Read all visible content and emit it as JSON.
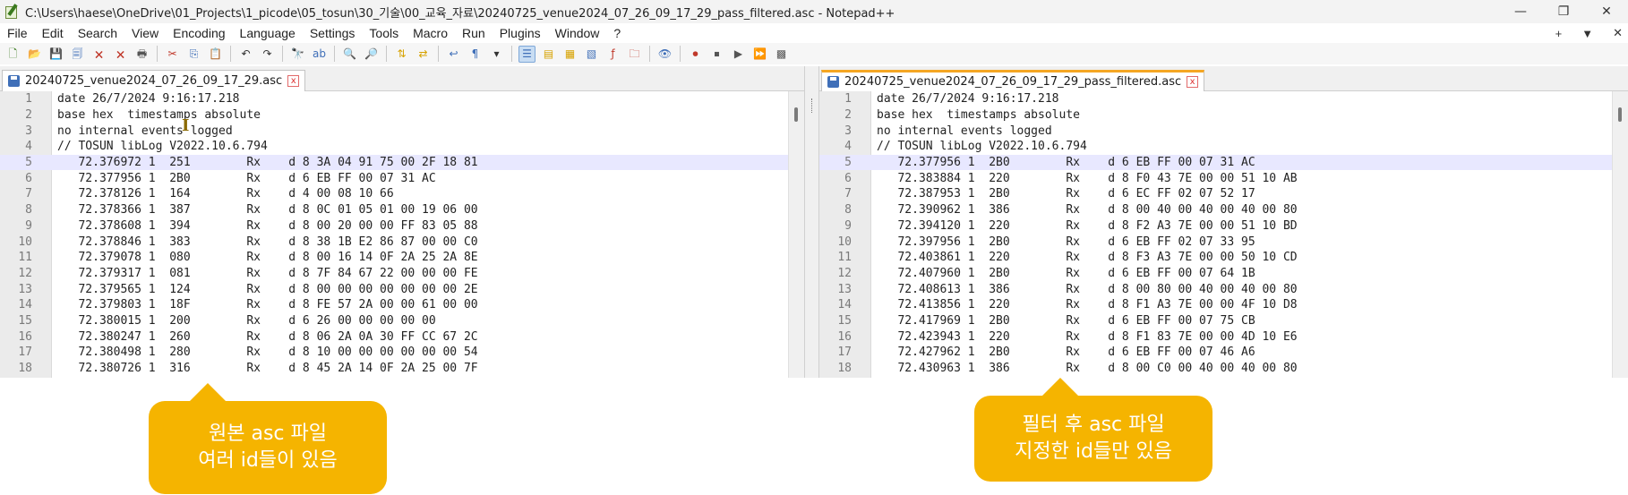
{
  "window": {
    "title": "C:\\Users\\haese\\OneDrive\\01_Projects\\1_picode\\05_tosun\\30_기술\\00_교육_자료\\20240725_venue2024_07_26_09_17_29_pass_filtered.asc - Notepad++",
    "minimize": "—",
    "maximize": "❐",
    "close": "✕"
  },
  "menu": {
    "items": [
      "File",
      "Edit",
      "Search",
      "View",
      "Encoding",
      "Language",
      "Settings",
      "Tools",
      "Macro",
      "Run",
      "Plugins",
      "Window",
      "?"
    ],
    "right": [
      "+",
      "▼",
      "✕"
    ]
  },
  "toolbar": {
    "icons": [
      {
        "name": "new-file-icon",
        "glyph": "🗋",
        "color": "#3b7a1f"
      },
      {
        "name": "open-file-icon",
        "glyph": "📂",
        "color": "#d7a200"
      },
      {
        "name": "save-icon",
        "glyph": "💾",
        "color": "#3f6fb8"
      },
      {
        "name": "save-all-icon",
        "glyph": "🗐",
        "color": "#3f6fb8"
      },
      {
        "name": "close-file-icon",
        "glyph": "🗙",
        "color": "#c0392b"
      },
      {
        "name": "close-all-icon",
        "glyph": "🗙",
        "color": "#c0392b"
      },
      {
        "name": "print-icon",
        "glyph": "🖶",
        "color": "#555555"
      },
      {
        "name": "cut-icon",
        "glyph": "✂",
        "color": "#c0392b"
      },
      {
        "name": "copy-icon",
        "glyph": "⎘",
        "color": "#3f6fb8"
      },
      {
        "name": "paste-icon",
        "glyph": "📋",
        "color": "#8a6d3b"
      },
      {
        "name": "undo-icon",
        "glyph": "↶",
        "color": "#333333"
      },
      {
        "name": "redo-icon",
        "glyph": "↷",
        "color": "#333333"
      },
      {
        "name": "find-icon",
        "glyph": "🔭",
        "color": "#333333"
      },
      {
        "name": "replace-icon",
        "glyph": "ab",
        "color": "#3f6fb8"
      },
      {
        "name": "zoom-in-icon",
        "glyph": "🔍",
        "color": "#3f6fb8"
      },
      {
        "name": "zoom-out-icon",
        "glyph": "🔎",
        "color": "#3f6fb8"
      },
      {
        "name": "sync-vertical-icon",
        "glyph": "⇅",
        "color": "#d7a200"
      },
      {
        "name": "sync-horizontal-icon",
        "glyph": "⇄",
        "color": "#d7a200"
      },
      {
        "name": "word-wrap-icon",
        "glyph": "↩",
        "color": "#3f6fb8"
      },
      {
        "name": "show-all-chars-icon",
        "glyph": "¶",
        "color": "#3f6fb8"
      },
      {
        "name": "dropdown-icon",
        "glyph": "▾",
        "color": "#333333"
      },
      {
        "name": "indent-guide-icon",
        "glyph": "☰",
        "color": "#3f6fb8"
      },
      {
        "name": "udl-icon",
        "glyph": "▤",
        "color": "#d7a200"
      },
      {
        "name": "doc-map-icon",
        "glyph": "▦",
        "color": "#d7a200"
      },
      {
        "name": "doc-list-icon",
        "glyph": "▧",
        "color": "#3f6fb8"
      },
      {
        "name": "function-list-icon",
        "glyph": "ƒ",
        "color": "#c0392b"
      },
      {
        "name": "folder-workspace-icon",
        "glyph": "🗀",
        "color": "#c0392b"
      },
      {
        "name": "monitoring-icon",
        "glyph": "👁",
        "color": "#3f6fb8"
      },
      {
        "name": "record-macro-icon",
        "glyph": "⏺",
        "color": "#c0392b"
      },
      {
        "name": "stop-macro-icon",
        "glyph": "⏹",
        "color": "#555555"
      },
      {
        "name": "play-macro-icon",
        "glyph": "▶",
        "color": "#555555"
      },
      {
        "name": "run-macro-multiple-icon",
        "glyph": "⏩",
        "color": "#3f6fb8"
      },
      {
        "name": "save-macro-icon",
        "glyph": "▩",
        "color": "#555555"
      }
    ]
  },
  "left_pane": {
    "tab_label": "20240725_venue2024_07_26_09_17_29.asc",
    "close": "x",
    "lines": [
      "date 26/7/2024 9:16:17.218",
      "base hex  timestamps absolute",
      "no internal events logged",
      "// TOSUN libLog V2022.10.6.794",
      "   72.376972 1  251        Rx    d 8 3A 04 91 75 00 2F 18 81",
      "   72.377956 1  2B0        Rx    d 6 EB FF 00 07 31 AC",
      "   72.378126 1  164        Rx    d 4 00 08 10 66",
      "   72.378366 1  387        Rx    d 8 0C 01 05 01 00 19 06 00",
      "   72.378608 1  394        Rx    d 8 00 20 00 00 FF 83 05 88",
      "   72.378846 1  383        Rx    d 8 38 1B E2 86 87 00 00 C0",
      "   72.379078 1  080        Rx    d 8 00 16 14 0F 2A 25 2A 8E",
      "   72.379317 1  081        Rx    d 8 7F 84 67 22 00 00 00 FE",
      "   72.379565 1  124        Rx    d 8 00 00 00 00 00 00 00 2E",
      "   72.379803 1  18F        Rx    d 8 FE 57 2A 00 00 61 00 00",
      "   72.380015 1  200        Rx    d 6 26 00 00 00 00 00",
      "   72.380247 1  260        Rx    d 8 06 2A 0A 30 FF CC 67 2C",
      "   72.380498 1  280        Rx    d 8 10 00 00 00 00 00 00 54",
      "   72.380726 1  316        Rx    d 8 45 2A 14 0F 2A 25 00 7F"
    ]
  },
  "right_pane": {
    "tab_label": "20240725_venue2024_07_26_09_17_29_pass_filtered.asc",
    "close": "x",
    "lines": [
      "date 26/7/2024 9:16:17.218",
      "base hex  timestamps absolute",
      "no internal events logged",
      "// TOSUN libLog V2022.10.6.794",
      "   72.377956 1  2B0        Rx    d 6 EB FF 00 07 31 AC",
      "   72.383884 1  220        Rx    d 8 F0 43 7E 00 00 51 10 AB",
      "   72.387953 1  2B0        Rx    d 6 EC FF 02 07 52 17",
      "   72.390962 1  386        Rx    d 8 00 40 00 40 00 40 00 80",
      "   72.394120 1  220        Rx    d 8 F2 A3 7E 00 00 51 10 BD",
      "   72.397956 1  2B0        Rx    d 6 EB FF 02 07 33 95",
      "   72.403861 1  220        Rx    d 8 F3 A3 7E 00 00 50 10 CD",
      "   72.407960 1  2B0        Rx    d 6 EB FF 00 07 64 1B",
      "   72.408613 1  386        Rx    d 8 00 80 00 40 00 40 00 80",
      "   72.413856 1  220        Rx    d 8 F1 A3 7E 00 00 4F 10 D8",
      "   72.417969 1  2B0        Rx    d 6 EB FF 00 07 75 CB",
      "   72.423943 1  220        Rx    d 8 F1 83 7E 00 00 4D 10 E6",
      "   72.427962 1  2B0        Rx    d 6 EB FF 00 07 46 A6",
      "   72.430963 1  386        Rx    d 8 00 C0 00 40 00 40 00 80"
    ]
  },
  "current_line": 5,
  "callouts": {
    "left": [
      "원본 asc 파일",
      "여러 id들이 있음"
    ],
    "right": [
      "필터 후 asc 파일",
      "지정한 id들만 있음"
    ]
  },
  "colors": {
    "callout": "#f5b400",
    "current_line": "#e8e8ff",
    "active_tab_accent": "#f5a623"
  }
}
